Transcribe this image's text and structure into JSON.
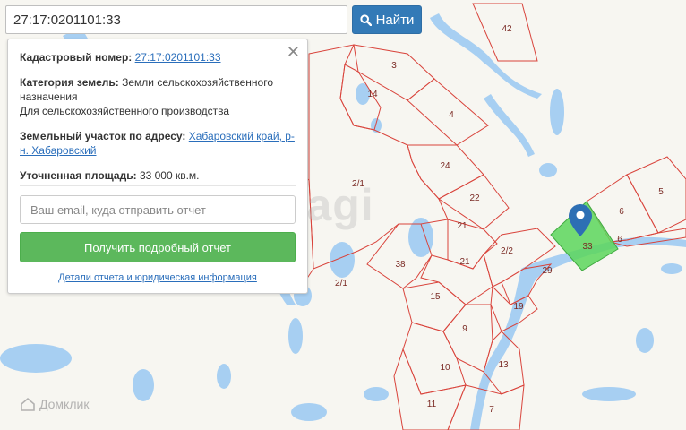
{
  "search": {
    "value": "27:17:0201101:33",
    "button_label": "Найти"
  },
  "panel": {
    "cadastral_label": "Кадастровый номер:",
    "cadastral_value": "27:17:0201101:33",
    "category_label": "Категория земель:",
    "category_value": "Земли сельскохозяйственного назначения",
    "category_use": "Для сельскохозяйственного производства",
    "address_label": "Земельный участок по адресу:",
    "address_value": "Хабаровский край, р-н. Хабаровский",
    "area_label": "Уточненная площадь:",
    "area_value": "33 000 кв.м.",
    "email_placeholder": "Ваш email, куда отправить отчет",
    "report_button": "Получить подробный отчет",
    "details_link": "Детали отчета и юридическая информация"
  },
  "map": {
    "watermark": "etagi",
    "attribution": "Домклик",
    "parcel_color": "#d9443c",
    "selected_color": "#5cd65c",
    "labels": [
      "42",
      "3",
      "14",
      "4",
      "24",
      "2/1",
      "22",
      "21",
      "38",
      "21",
      "2/2",
      "29",
      "15",
      "19",
      "2/1",
      "9",
      "10",
      "13",
      "11",
      "7",
      "5",
      "6",
      "6",
      "33"
    ]
  }
}
